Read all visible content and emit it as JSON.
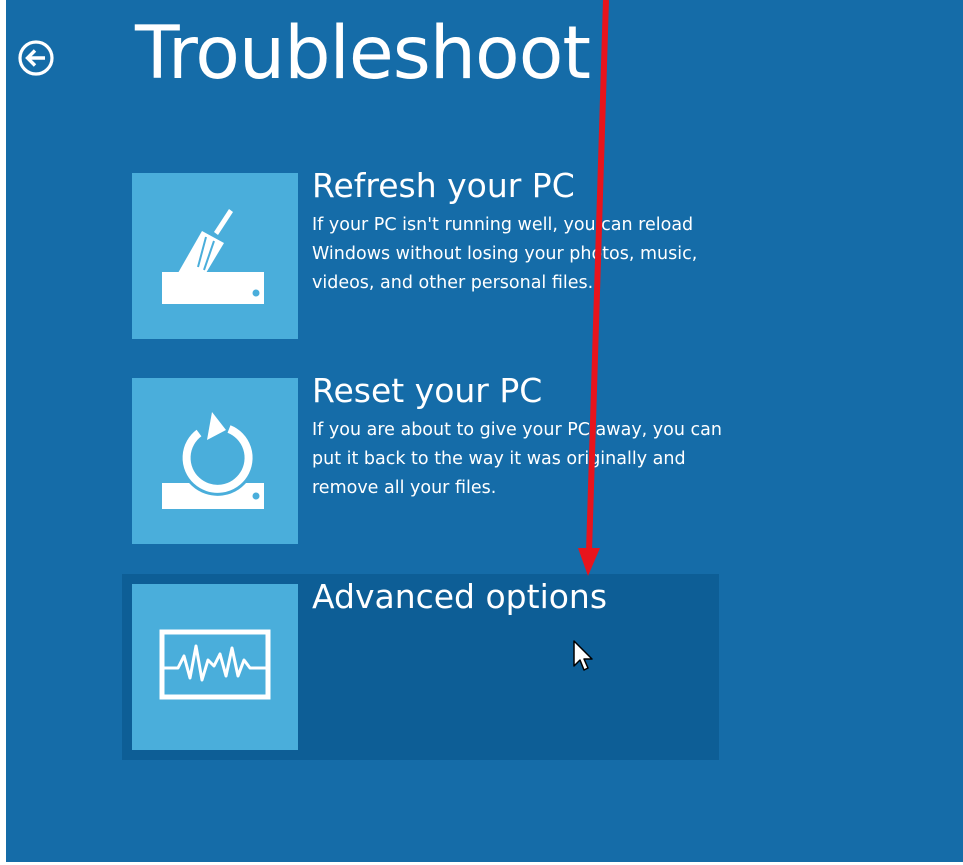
{
  "header": {
    "title": "Troubleshoot",
    "back_icon": "back-arrow-circle-icon"
  },
  "options": [
    {
      "title": "Refresh your PC",
      "description": "If your PC isn't running well, you can reload Windows without losing your photos, music, videos, and other personal files.",
      "icon": "broom-drive-icon"
    },
    {
      "title": "Reset your PC",
      "description": "If you are about to give your PC away, you can put it back to the way it was originally and remove all your files.",
      "icon": "reset-arrow-drive-icon"
    },
    {
      "title": "Advanced options",
      "description": "",
      "icon": "heartbeat-monitor-icon",
      "selected": true
    }
  ],
  "colors": {
    "background": "#156ca8",
    "tile": "#4aaedb",
    "selected_row": "#0d5e96",
    "annotation_arrow": "#e8141c",
    "text": "#ffffff"
  },
  "annotation": {
    "icon": "red-arrow-annotation"
  },
  "pointer": {
    "icon": "mouse-pointer-icon"
  }
}
